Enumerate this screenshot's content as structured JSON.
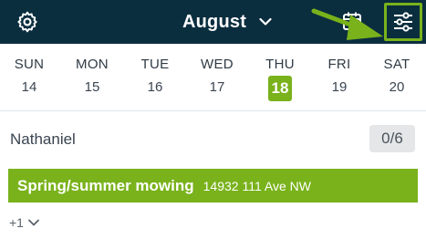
{
  "header": {
    "month_label": "August",
    "settings_icon": "gear-icon",
    "month_icon": "chevron-down-icon",
    "calendar_icon": "calendar-icon",
    "filter_icon": "sliders-icon",
    "background_color": "#0b2e3f",
    "accent_color": "#79b21b"
  },
  "week": {
    "days": [
      {
        "name": "SUN",
        "num": "14"
      },
      {
        "name": "MON",
        "num": "15"
      },
      {
        "name": "TUE",
        "num": "16"
      },
      {
        "name": "WED",
        "num": "17"
      },
      {
        "name": "THU",
        "num": "18"
      },
      {
        "name": "FRI",
        "num": "19"
      },
      {
        "name": "SAT",
        "num": "20"
      }
    ],
    "selected_day": "18"
  },
  "crew": {
    "name": "Nathaniel",
    "count": "0/6"
  },
  "job": {
    "title": "Spring/summer mowing",
    "address": "14932 111 Ave NW",
    "color": "#79b21b"
  },
  "more": {
    "label": "+1",
    "icon": "chevron-down-icon"
  }
}
